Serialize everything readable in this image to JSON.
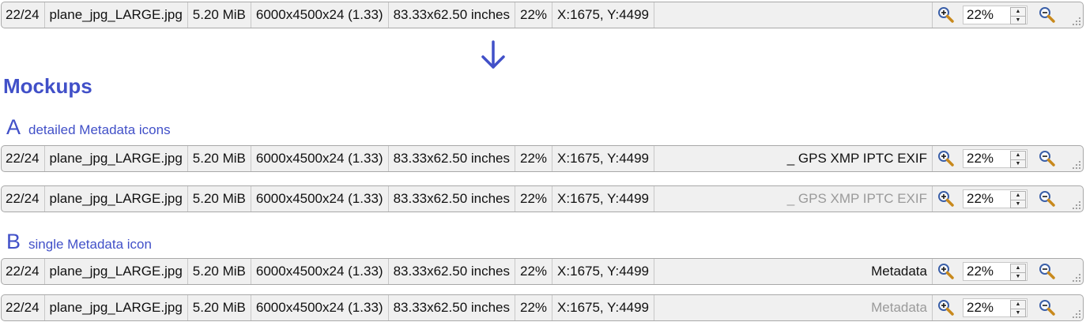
{
  "statusbar": {
    "index": "22/24",
    "filename": "plane_jpg_LARGE.jpg",
    "filesize": "5.20 MiB",
    "dimensions": "6000x4500x24 (1.33)",
    "print_size": "83.33x62.50 inches",
    "zoom_percent": "22%",
    "cursor_position": "X:1675, Y:4499",
    "zoom_input_value": "22%"
  },
  "page": {
    "heading": "Mockups",
    "section_a_letter": "A",
    "section_a_desc": "detailed Metadata icons",
    "section_b_letter": "B",
    "section_b_desc": "single Metadata icon",
    "metadata_detailed": "_ GPS XMP IPTC EXIF",
    "metadata_single": "Metadata"
  },
  "colors": {
    "accent": "#4150c8",
    "dim_text": "#9a9a9a",
    "bar_bg": "#f0f0f0"
  },
  "icons": [
    "zoom-in-icon",
    "zoom-out-icon",
    "resize-grip-icon",
    "down-arrow-icon",
    "spin-up-icon",
    "spin-down-icon"
  ]
}
